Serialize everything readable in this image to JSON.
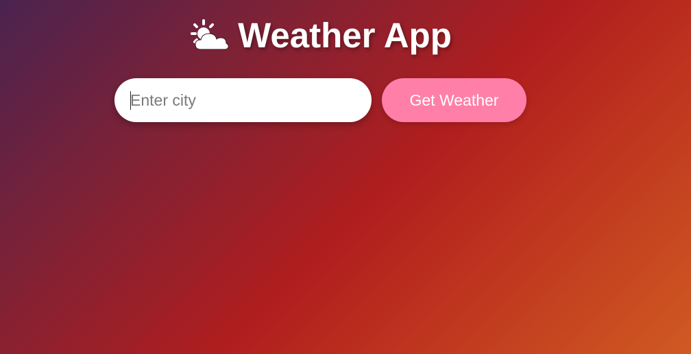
{
  "header": {
    "icon": "sun-behind-cloud-icon",
    "title": "Weather App"
  },
  "search": {
    "placeholder": "Enter city",
    "value": "",
    "button_label": "Get Weather"
  },
  "colors": {
    "button": "#ff7fa9",
    "gradient_start": "#4a2350",
    "gradient_mid": "#b01e1e",
    "gradient_end": "#cf5a22"
  }
}
